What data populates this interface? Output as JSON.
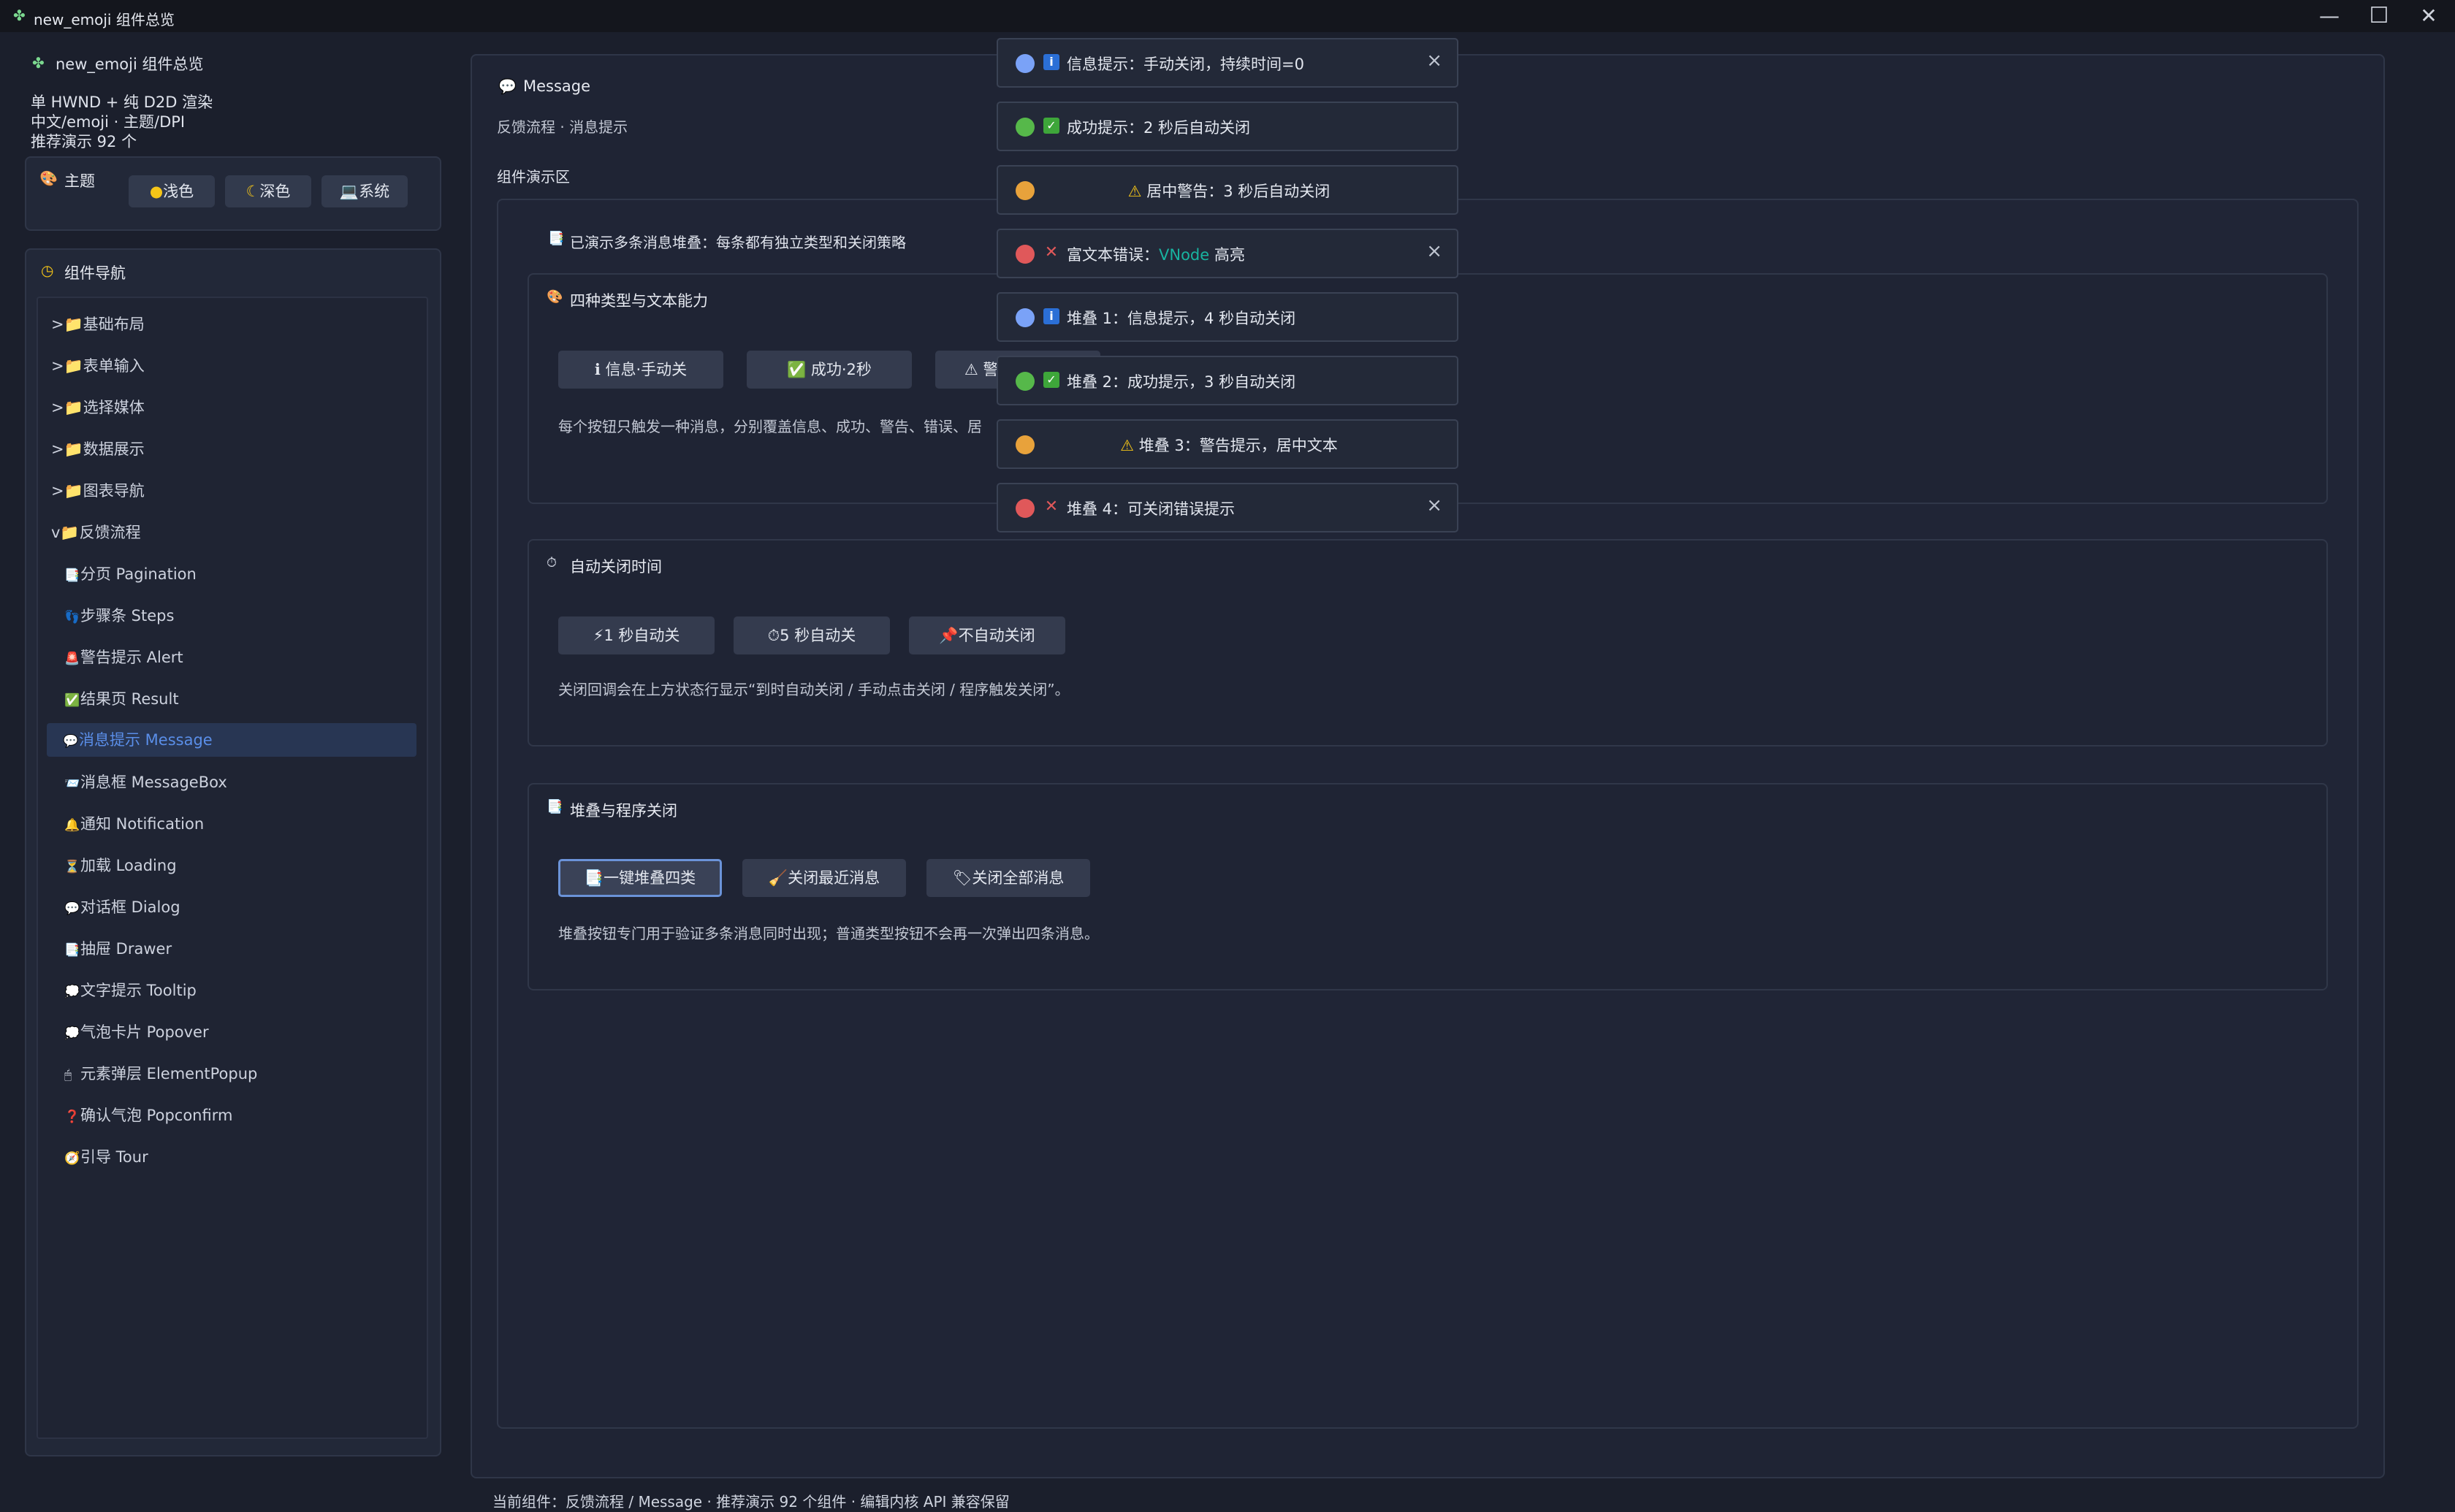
{
  "window": {
    "title": "new_emoji 组件总览",
    "minimize": "—",
    "maximize": "☐",
    "close": "✕"
  },
  "sidebar": {
    "app_name": "new_emoji 组件总览",
    "info_lines": [
      "单 HWND + 纯 D2D 渲染",
      "中文/emoji · 主题/DPI",
      "推荐演示 92 个"
    ],
    "theme": {
      "title": "主题",
      "buttons": [
        "浅色",
        "深色",
        "系统"
      ]
    },
    "nav": {
      "title": "组件导航",
      "folders": [
        {
          "label": ">📁基础布局"
        },
        {
          "label": ">📁表单输入"
        },
        {
          "label": ">📁选择媒体"
        },
        {
          "label": ">📁数据展示"
        },
        {
          "label": ">📁图表导航"
        },
        {
          "label": "v📁反馈流程"
        }
      ],
      "items": [
        {
          "icon": "📑",
          "label": "分页 Pagination"
        },
        {
          "icon": "👣",
          "label": "步骤条 Steps"
        },
        {
          "icon": "🚨",
          "label": "警告提示 Alert"
        },
        {
          "icon": "✅",
          "label": "结果页 Result"
        },
        {
          "icon": "💬",
          "label": "消息提示 Message"
        },
        {
          "icon": "📨",
          "label": "消息框 MessageBox"
        },
        {
          "icon": "🔔",
          "label": "通知 Notification"
        },
        {
          "icon": "⏳",
          "label": "加载 Loading"
        },
        {
          "icon": "💬",
          "label": "对话框 Dialog"
        },
        {
          "icon": "📑",
          "label": "抽屉 Drawer"
        },
        {
          "icon": "💭",
          "label": "文字提示 Tooltip"
        },
        {
          "icon": "💭",
          "label": "气泡卡片 Popover"
        },
        {
          "icon": "🖱",
          "label": "元素弹层 ElementPopup"
        },
        {
          "icon": "❓",
          "label": "确认气泡 Popconfirm"
        },
        {
          "icon": "🧭",
          "label": "引导 Tour"
        }
      ]
    }
  },
  "main": {
    "title": "Message",
    "breadcrumb": "反馈流程 · 消息提示",
    "demo_area_label": "组件演示区",
    "status_text": "已演示多条消息堆叠：每条都有独立类型和关闭策略",
    "sections": {
      "types": {
        "title": "四种类型与文本能力",
        "buttons": [
          "ℹ 信息·手动关",
          "✅ 成功·2秒",
          "⚠ 警"
        ],
        "desc": "每个按钮只触发一种消息，分别覆盖信息、成功、警告、错误、居"
      },
      "auto_close": {
        "title": "自动关闭时间",
        "buttons": [
          "⚡1 秒自动关",
          "⏱5 秒自动关",
          "📌不自动关闭"
        ],
        "desc": "关闭回调会在上方状态行显示“到时自动关闭 / 手动点击关闭 / 程序触发关闭”。"
      },
      "stack": {
        "title": "堆叠与程序关闭",
        "buttons": [
          "📑一键堆叠四类",
          "🧹关闭最近消息",
          "🏷关闭全部消息"
        ],
        "desc": "堆叠按钮专门用于验证多条消息同时出现；普通类型按钮不会再一次弹出四条消息。"
      }
    }
  },
  "footer": {
    "text": "当前组件：反馈流程 / Message · 推荐演示 92 个组件 · 编辑内核 API 兼容保留"
  },
  "toasts": [
    {
      "type": "info",
      "text": "信息提示：手动关闭，持续时间=0",
      "closable": true
    },
    {
      "type": "success",
      "text": "成功提示：2 秒后自动关闭",
      "closable": false
    },
    {
      "type": "warning",
      "text": "居中警告：3 秒后自动关闭",
      "closable": false
    },
    {
      "type": "error",
      "text_prefix": "富文本错误：",
      "text_highlight": "VNode",
      "text_suffix": " 高亮",
      "closable": true
    },
    {
      "type": "info",
      "text": "堆叠 1：信息提示，4 秒自动关闭",
      "closable": false
    },
    {
      "type": "success",
      "text": "堆叠 2：成功提示，3 秒自动关闭",
      "closable": false
    },
    {
      "type": "warning",
      "text": "堆叠 3：警告提示，居中文本",
      "closable": false
    },
    {
      "type": "error",
      "text": "堆叠 4：可关闭错误提示",
      "closable": true
    }
  ],
  "colors": {
    "info": "#7aa2f7",
    "success": "#56b84a",
    "warning": "#e8a23b",
    "error": "#e0585a",
    "highlight": "#18b3a0",
    "accent": "#5a8ee8"
  }
}
